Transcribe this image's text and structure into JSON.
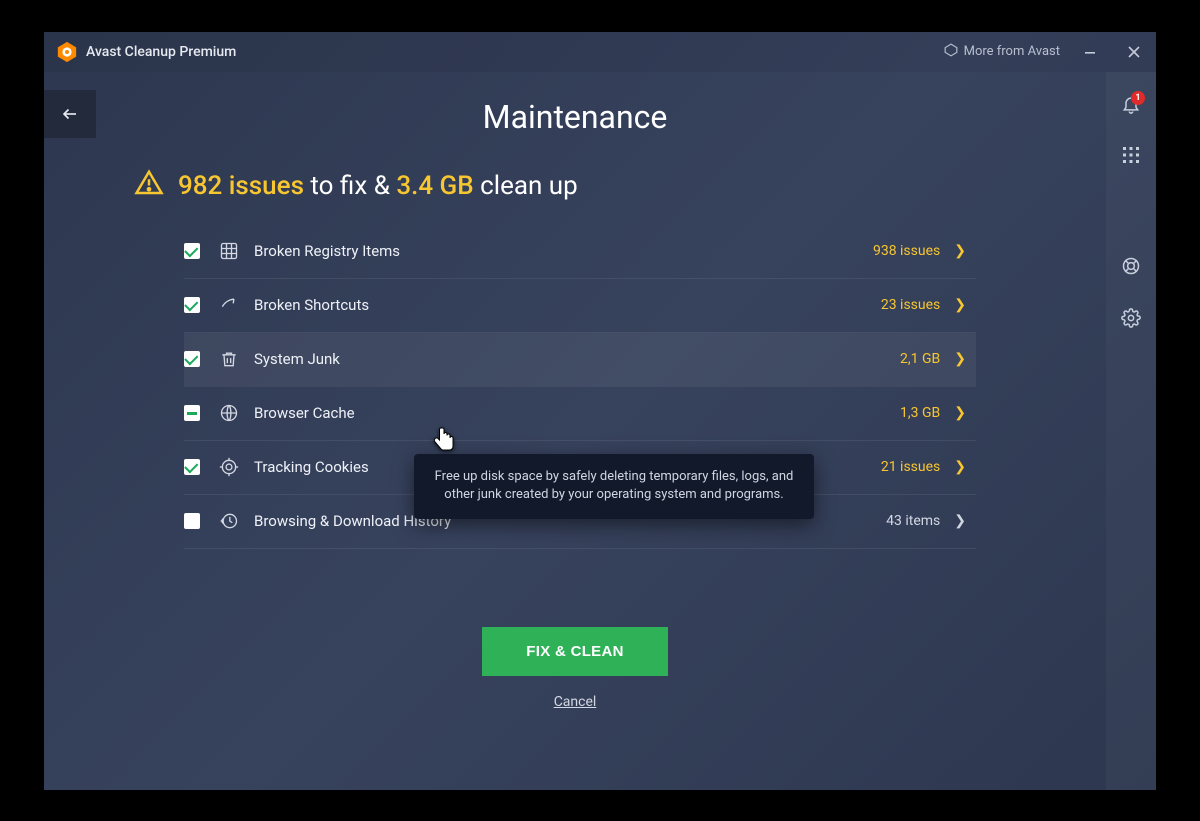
{
  "titlebar": {
    "app_name": "Avast Cleanup Premium",
    "more_from": "More from Avast"
  },
  "rightbar": {
    "notification_count": "1"
  },
  "page": {
    "title": "Maintenance",
    "summary_issues": "982 issues",
    "summary_mid": " to fix & ",
    "summary_size": "3.4 GB",
    "summary_tail": " clean up"
  },
  "items": [
    {
      "label": "Broken Registry Items",
      "value": "938 issues",
      "check": "checked",
      "accent": true
    },
    {
      "label": "Broken Shortcuts",
      "value": "23 issues",
      "check": "checked",
      "accent": true
    },
    {
      "label": "System Junk",
      "value": "2,1 GB",
      "check": "checked",
      "accent": true,
      "highlight": true
    },
    {
      "label": "Browser Cache",
      "value": "1,3 GB",
      "check": "partial",
      "accent": true
    },
    {
      "label": "Tracking Cookies",
      "value": "21 issues",
      "check": "checked",
      "accent": true
    },
    {
      "label": "Browsing & Download History",
      "value": "43 items",
      "check": "empty",
      "accent": false
    }
  ],
  "tooltip": "Free up disk space by safely deleting temporary files, logs, and other junk created by your operating system and programs.",
  "actions": {
    "fix": "FIX & CLEAN",
    "cancel": "Cancel"
  }
}
